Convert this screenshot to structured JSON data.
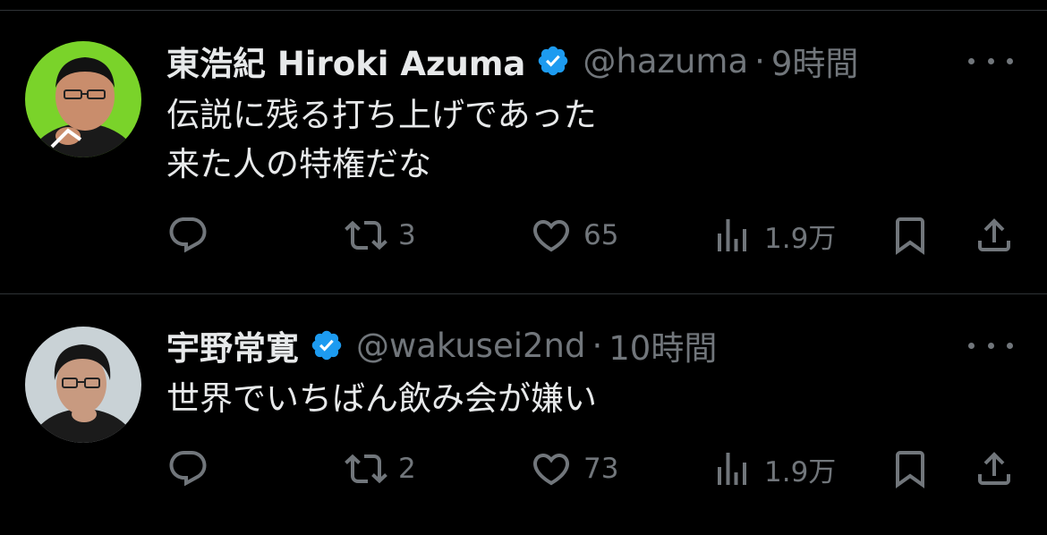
{
  "tweets": [
    {
      "name": "東浩紀 Hiroki Azuma",
      "handle": "@hazuma",
      "separator": "·",
      "time": "9時間",
      "text_lines": [
        "伝説に残る打ち上げであった",
        "来た人の特権だな"
      ],
      "replies": "",
      "retweets": "3",
      "likes": "65",
      "views": "1.9万",
      "avatar_bg": "#7ad32a"
    },
    {
      "name": "宇野常寛",
      "handle": "@wakusei2nd",
      "separator": "·",
      "time": "10時間",
      "text_lines": [
        "世界でいちばん飲み会が嫌い"
      ],
      "replies": "",
      "retweets": "2",
      "likes": "73",
      "views": "1.9万",
      "avatar_bg": "#c9d2d6"
    }
  ],
  "colors": {
    "background": "#000000",
    "text": "#e7e9ea",
    "secondary": "#71767b",
    "verified": "#1d9bf0",
    "separator": "#2f3336"
  },
  "icons": [
    "verified-badge-icon",
    "more-icon",
    "reply-icon",
    "retweet-icon",
    "like-icon",
    "views-icon",
    "bookmark-icon",
    "share-icon"
  ]
}
